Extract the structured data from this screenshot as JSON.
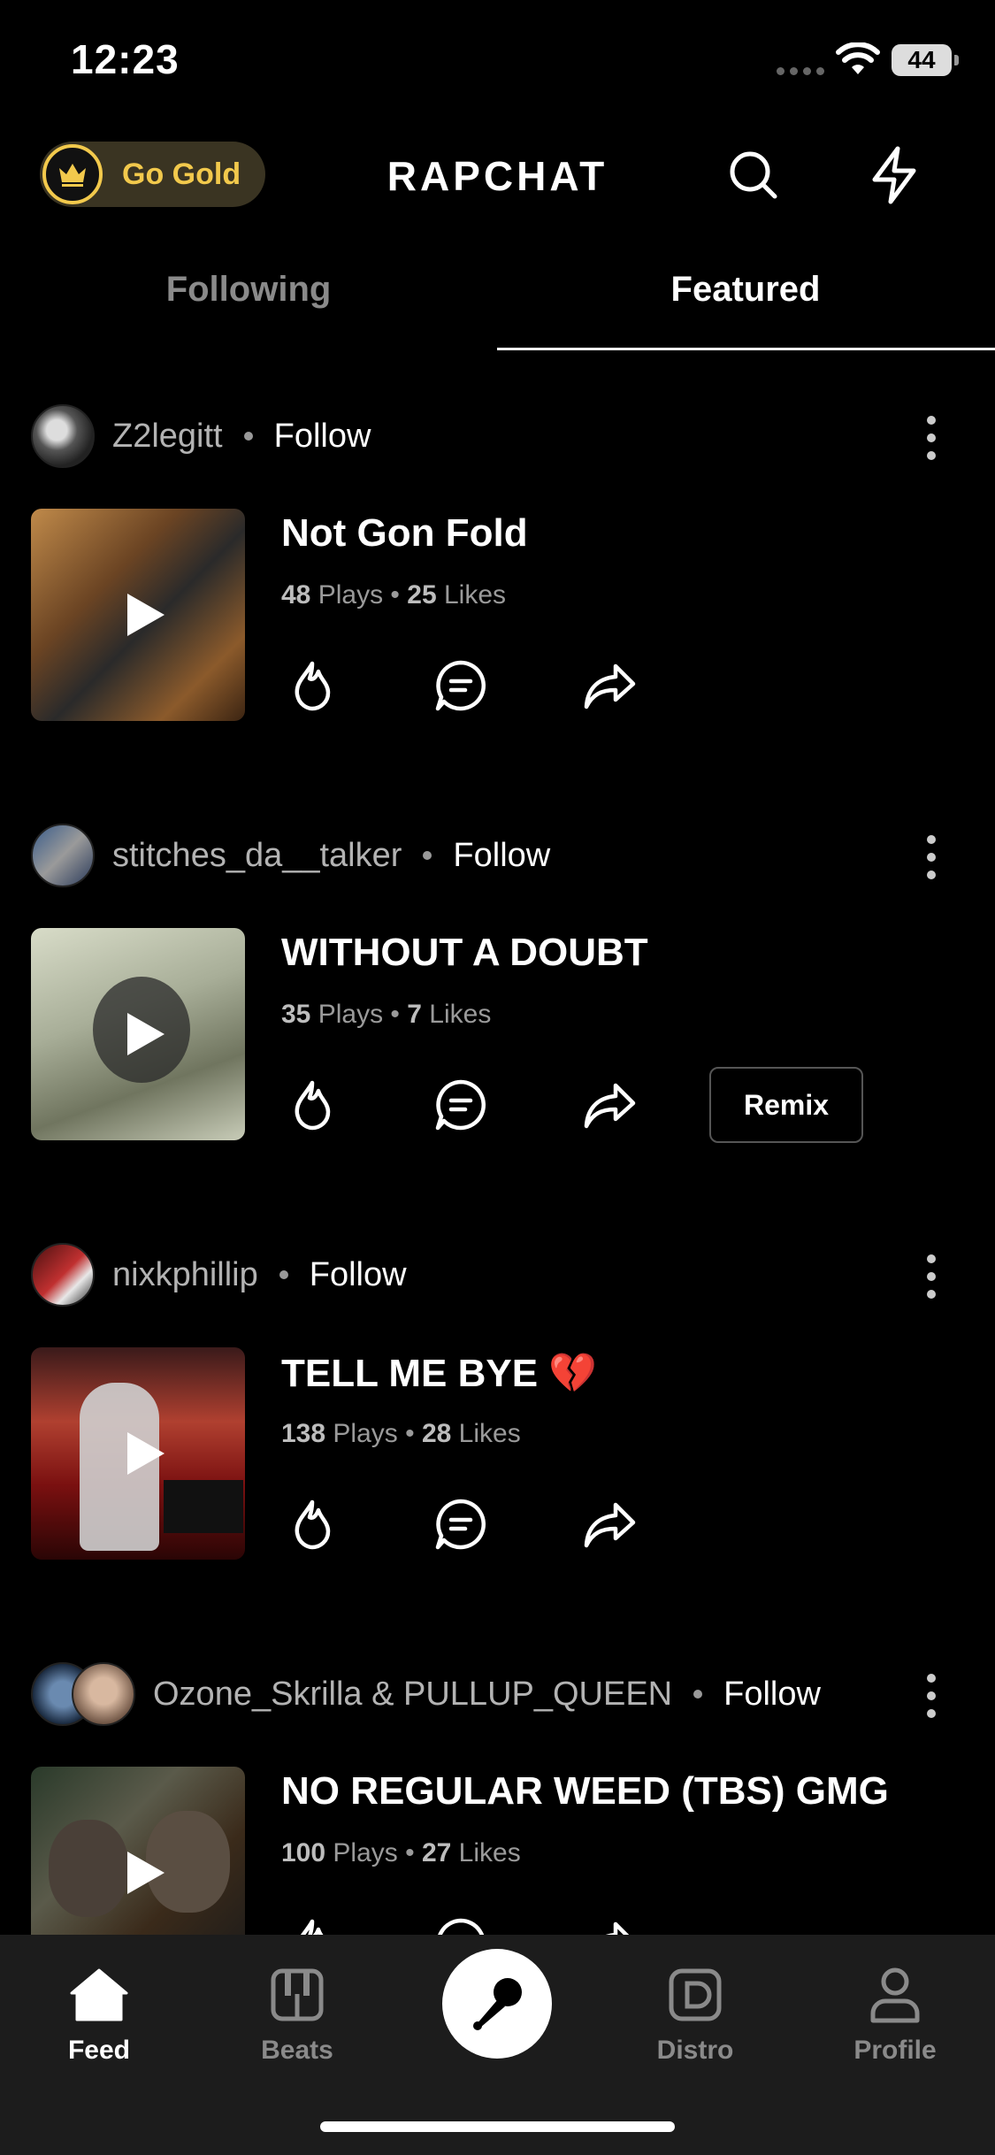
{
  "status_bar": {
    "time": "12:23",
    "battery": "44"
  },
  "header": {
    "go_gold_label": "Go Gold",
    "logo": "RAPCHAT"
  },
  "tabs": [
    {
      "label": "Following",
      "active": false
    },
    {
      "label": "Featured",
      "active": true
    }
  ],
  "posts": [
    {
      "user": "Z2legitt",
      "follow_label": "Follow",
      "title": "Not Gon Fold",
      "plays": "48",
      "plays_label": "Plays",
      "likes": "25",
      "likes_label": "Likes",
      "remix_label": ""
    },
    {
      "user": "stitches_da__talker",
      "follow_label": "Follow",
      "title": "WITHOUT A DOUBT",
      "plays": "35",
      "plays_label": "Plays",
      "likes": "7",
      "likes_label": "Likes",
      "remix_label": "Remix"
    },
    {
      "user": "nixkphillip",
      "follow_label": "Follow",
      "title": "TELL ME BYE 💔",
      "plays": "138",
      "plays_label": "Plays",
      "likes": "28",
      "likes_label": "Likes",
      "remix_label": ""
    },
    {
      "user": "Ozone_Skrilla & PULLUP_QUEEN",
      "follow_label": "Follow",
      "title": "NO REGULAR WEED (TBS) GMG",
      "plays": "100",
      "plays_label": "Plays",
      "likes": "27",
      "likes_label": "Likes",
      "remix_label": ""
    }
  ],
  "bottom_nav": [
    {
      "label": "Feed",
      "icon": "home-icon",
      "active": true
    },
    {
      "label": "Beats",
      "icon": "piano-icon",
      "active": false
    },
    {
      "label": "",
      "icon": "microphone-icon",
      "active": false
    },
    {
      "label": "Distro",
      "icon": "distro-icon",
      "active": false
    },
    {
      "label": "Profile",
      "icon": "person-icon",
      "active": false
    }
  ],
  "colors": {
    "gold": "#f2c94c",
    "background": "#000000",
    "nav_background": "#1c1c1c"
  }
}
